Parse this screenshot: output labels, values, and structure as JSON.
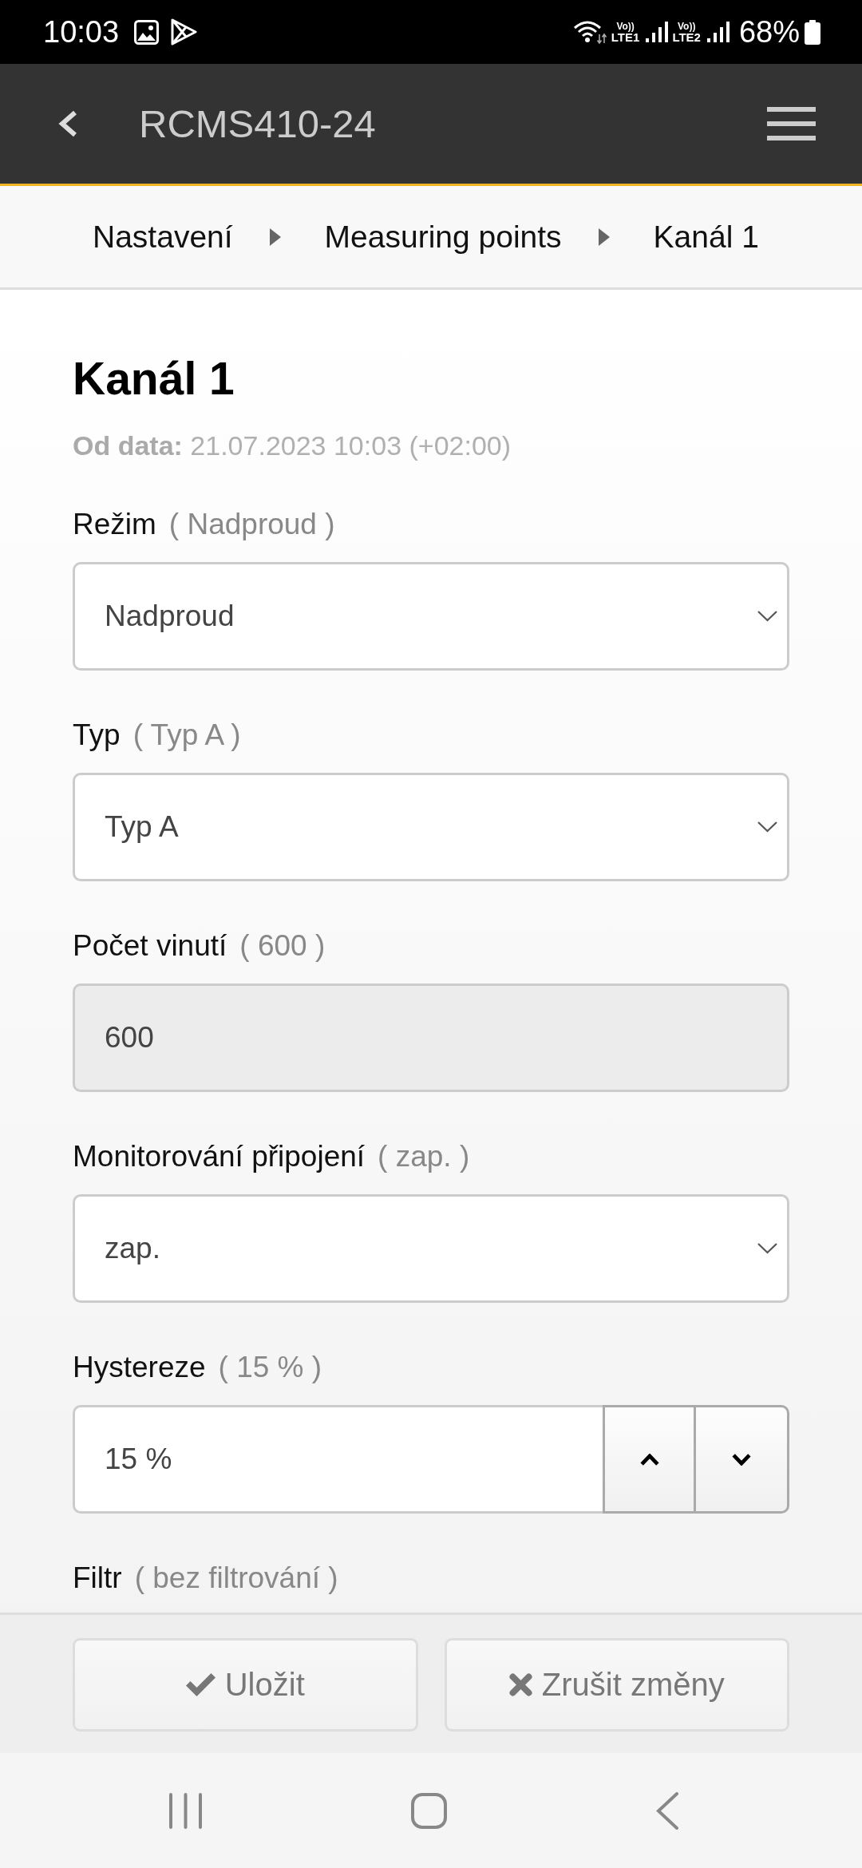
{
  "status_bar": {
    "time": "10:03",
    "sims": [
      {
        "volte": "Vo))",
        "network": "LTE1"
      },
      {
        "volte": "Vo))",
        "network": "LTE2"
      }
    ],
    "battery": "68%"
  },
  "header": {
    "title": "RCMS410-24"
  },
  "breadcrumb": [
    {
      "label": "Nastavení"
    },
    {
      "label": "Measuring points"
    },
    {
      "label": "Kanál 1"
    }
  ],
  "page": {
    "title": "Kanál 1",
    "valid_from": "**Od data:** 21.07.2023 10:03 (+02:00)"
  },
  "fields": [
    {
      "kind": "select",
      "label": "Režim",
      "current": "( Nadproud )",
      "value": "Nadproud",
      "disabled": false
    },
    {
      "kind": "select",
      "label": "Typ",
      "current": "( Typ A )",
      "value": "Typ A",
      "disabled": false
    },
    {
      "kind": "input",
      "label": "Počet vinutí",
      "current": "( 600 )",
      "value": "600",
      "disabled": true
    },
    {
      "kind": "select",
      "label": "Monitorování připojení",
      "current": "( zap. )",
      "value": "zap.",
      "disabled": false
    },
    {
      "kind": "number",
      "label": "Hystereze",
      "current": "( 15 % )",
      "value": "15 %",
      "disabled": false
    },
    {
      "label": "Filtr",
      "current": "( bez filtrování )"
    }
  ],
  "footer": {
    "buttons": [
      {
        "kind": "save",
        "label": "Uložit"
      },
      {
        "kind": "cancel",
        "label": "Zrušit změny"
      }
    ]
  }
}
